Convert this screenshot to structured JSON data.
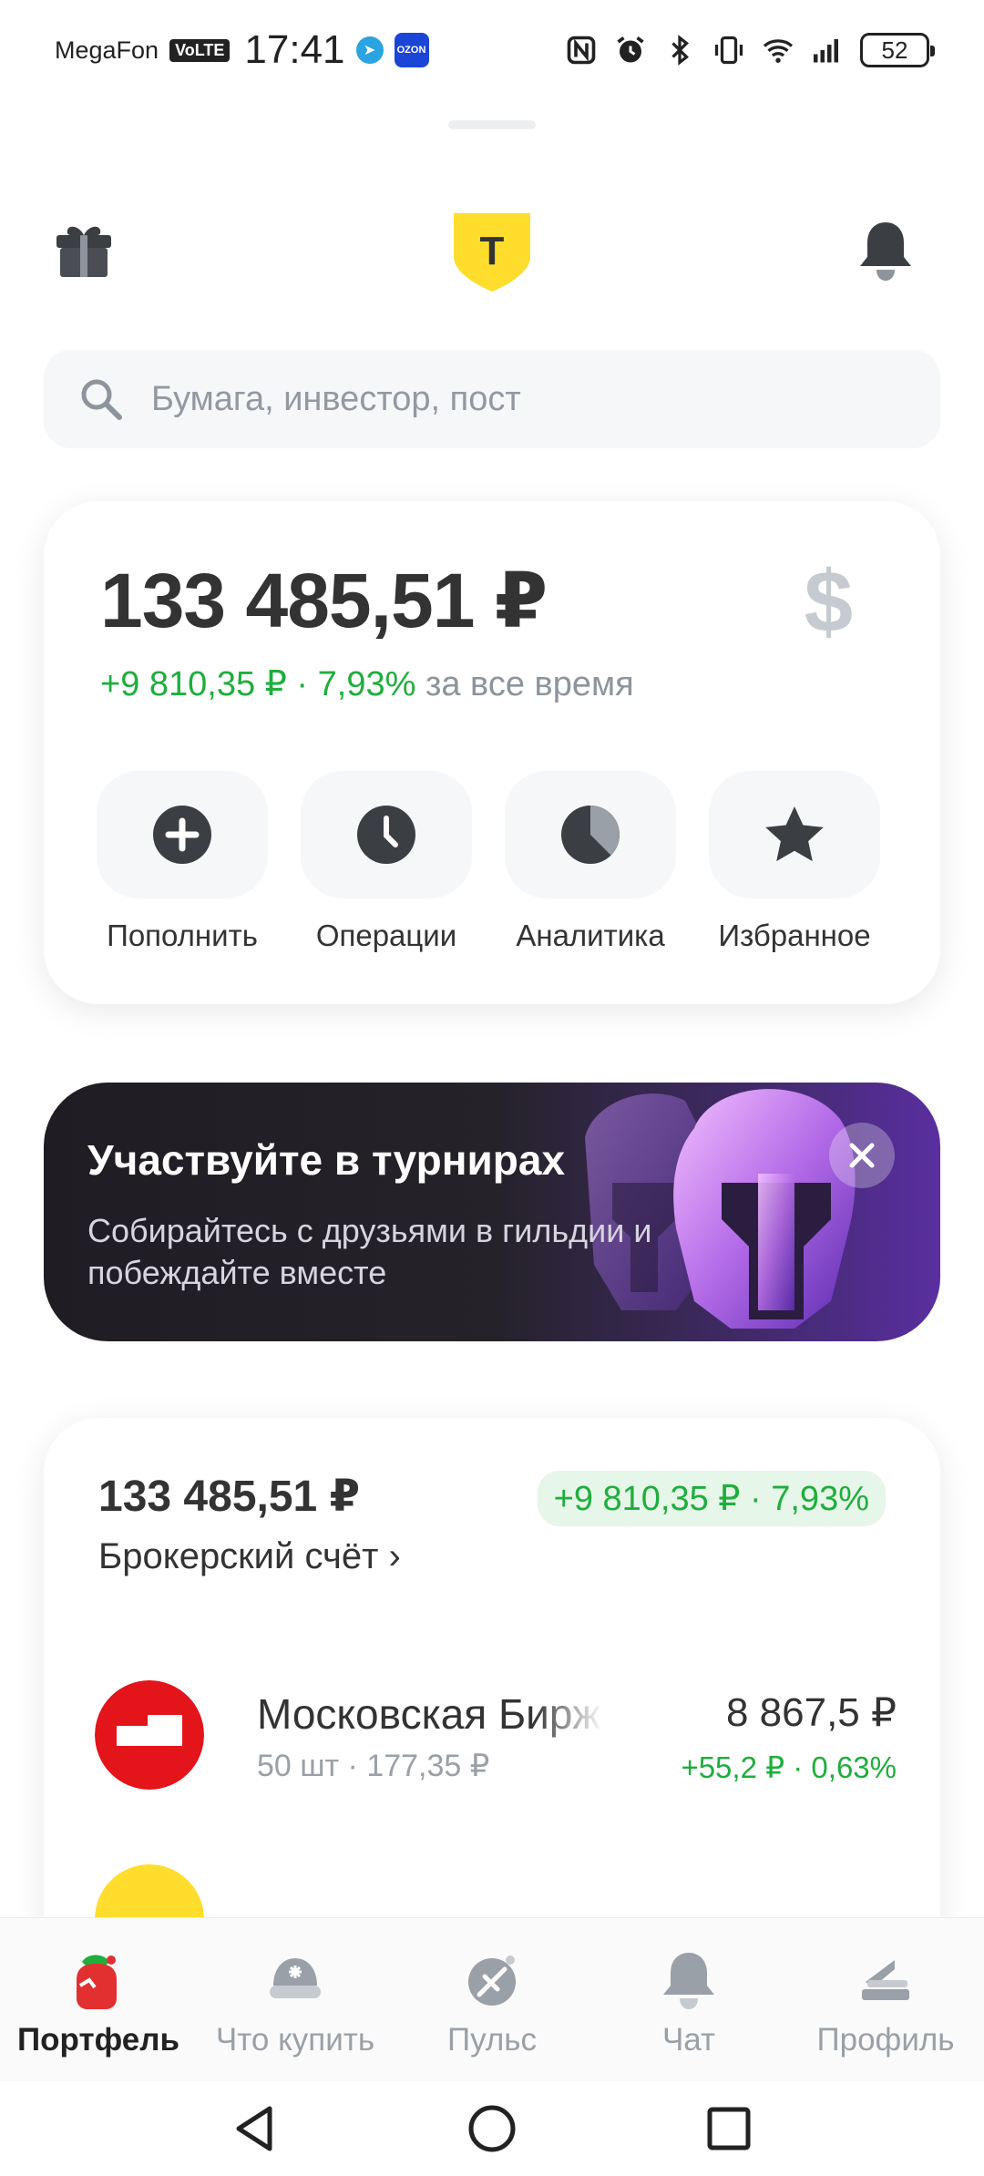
{
  "status_bar": {
    "carrier": "MegaFon",
    "volte": "VoLTE",
    "time": "17:41",
    "ozon_label": "OZON",
    "battery": "52",
    "icons": [
      "nfc-icon",
      "alarm-icon",
      "bluetooth-icon",
      "vibrate-icon",
      "wifi-icon",
      "signal-icon",
      "battery-icon"
    ]
  },
  "header": {
    "left_icon": "gift-icon",
    "logo_letter": "Т",
    "right_icon": "bell-icon"
  },
  "search": {
    "placeholder": "Бумага, инвестор, пост"
  },
  "balance": {
    "amount": "133 485,51 ₽",
    "currency_icon": "$",
    "change_abs": "+9 810,35 ₽",
    "separator": " · ",
    "change_pct": "7,93%",
    "period": "за все время",
    "actions": [
      {
        "label": "Пополнить",
        "icon": "plus-icon"
      },
      {
        "label": "Операции",
        "icon": "clock-icon"
      },
      {
        "label": "Аналитика",
        "icon": "pie-chart-icon"
      },
      {
        "label": "Избранное",
        "icon": "star-icon"
      }
    ]
  },
  "promo": {
    "title": "Участвуйте в турнирах",
    "subtitle": "Собирайтесь с друзьями в гильдии и побеждайте вместе",
    "art_icon": "helmet-icon"
  },
  "portfolio": {
    "total": "133 485,51 ₽",
    "badge": "+9 810,35 ₽ · 7,93%",
    "account": "Брокерский счёт ›",
    "assets": [
      {
        "name": "Московская Биржа",
        "qty": "50 шт · 177,35 ₽",
        "value": "8 867,5 ₽",
        "change": "+55,2 ₽ · 0,63%"
      }
    ]
  },
  "bottom_nav": [
    {
      "label": "Портфель",
      "icon": "portfolio-icon",
      "active": true
    },
    {
      "label": "Что купить",
      "icon": "what-to-buy-icon",
      "active": false
    },
    {
      "label": "Пульс",
      "icon": "pulse-icon",
      "active": false
    },
    {
      "label": "Чат",
      "icon": "chat-icon",
      "active": false
    },
    {
      "label": "Профиль",
      "icon": "profile-icon",
      "active": false
    }
  ],
  "colors": {
    "accent_green": "#1fae3d",
    "brand_yellow": "#ffdd2d",
    "moex_red": "#e4141b"
  }
}
